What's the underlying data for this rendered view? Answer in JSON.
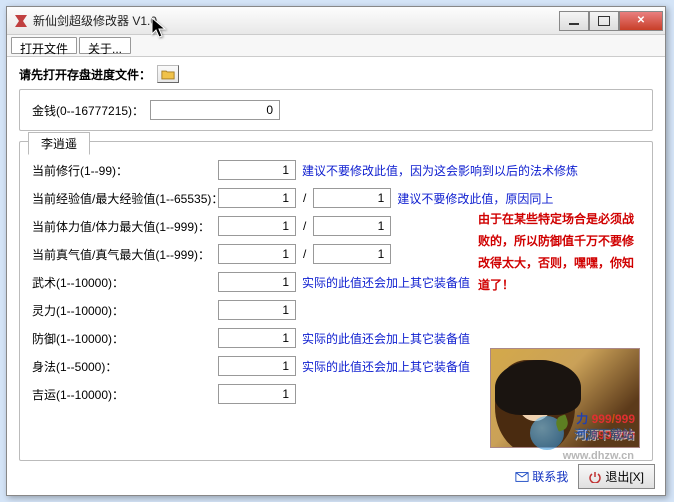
{
  "window": {
    "title": "新仙剑超级修改器 V1.0"
  },
  "menu": {
    "open_file": "打开文件",
    "about": "关于..."
  },
  "top": {
    "prompt": "请先打开存盘进度文件："
  },
  "money": {
    "label": "金钱(0--16777215)：",
    "value": "0"
  },
  "tab": {
    "name": "李逍遥"
  },
  "fields": {
    "cultivation": {
      "label": "当前修行(1--99)：",
      "v": "1",
      "hint": "建议不要修改此值，因为这会影响到以后的法术修炼"
    },
    "exp": {
      "label": "当前经验值/最大经验值(1--65535)：",
      "v1": "1",
      "v2": "1",
      "hint": "建议不要修改此值，原因同上"
    },
    "hp": {
      "label": "当前体力值/体力最大值(1--999)：",
      "v1": "1",
      "v2": "1"
    },
    "mp": {
      "label": "当前真气值/真气最大值(1--999)：",
      "v1": "1",
      "v2": "1"
    },
    "wushu": {
      "label": "武术(1--10000)：",
      "v": "1",
      "hint": "实际的此值还会加上其它装备值"
    },
    "lingli": {
      "label": "灵力(1--10000)：",
      "v": "1"
    },
    "fangyu": {
      "label": "防御(1--10000)：",
      "v": "1",
      "hint": "实际的此值还会加上其它装备值"
    },
    "shenfa": {
      "label": "身法(1--5000)：",
      "v": "1",
      "hint": "实际的此值还会加上其它装备值"
    },
    "jiyun": {
      "label": "吉运(1--10000)：",
      "v": "1"
    }
  },
  "warning": "由于在某些特定场合是必须战败的，所以防御值千万不要修改得太大，否则，嘿嘿，你知道了！",
  "portrait": {
    "li": "力",
    "qi": "气",
    "val": "999",
    "sep": "/"
  },
  "footer": {
    "contact": "联系我",
    "exit": "退出[X]"
  },
  "watermark": {
    "text": "河源下载站",
    "url": "www.dhzw.cn"
  }
}
